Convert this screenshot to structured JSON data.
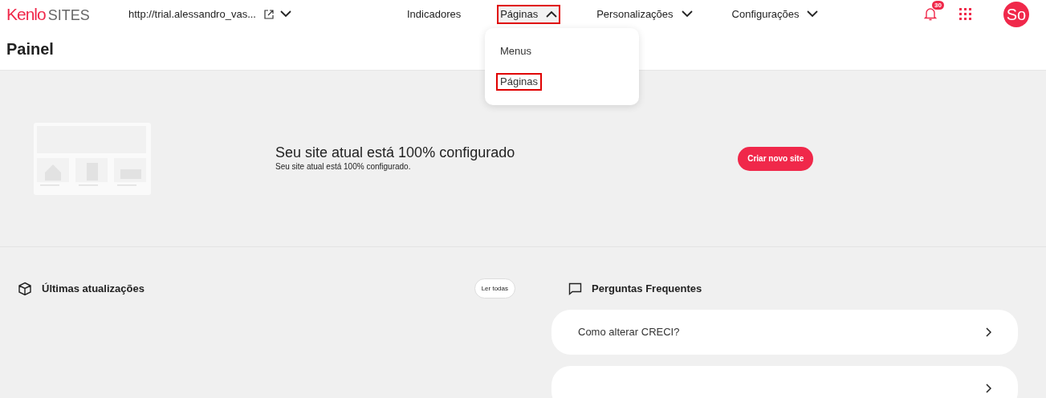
{
  "logo": {
    "brand": "Kenlo",
    "product": "SITES"
  },
  "site_url": "http://trial.alessandro_vas...",
  "nav": [
    {
      "label": "Indicadores",
      "has_menu": false,
      "expanded": false,
      "highlighted": false
    },
    {
      "label": "Páginas",
      "has_menu": true,
      "expanded": true,
      "highlighted": true
    },
    {
      "label": "Personalizações",
      "has_menu": true,
      "expanded": false,
      "highlighted": false
    },
    {
      "label": "Configurações",
      "has_menu": true,
      "expanded": false,
      "highlighted": false
    }
  ],
  "dropdown": [
    {
      "label": "Menus",
      "highlighted": false
    },
    {
      "label": "Páginas",
      "highlighted": true
    }
  ],
  "notifications": {
    "count": "30"
  },
  "avatar": {
    "initials": "So"
  },
  "page_title": "Painel",
  "hero": {
    "title": "Seu site atual está 100% configurado",
    "subtitle": "Seu site atual está 100% configurado.",
    "button": "Criar novo site"
  },
  "updates": {
    "title": "Últimas atualizações",
    "button": "Ler todas"
  },
  "faq": {
    "title": "Perguntas Frequentes",
    "items": [
      {
        "kind": "question",
        "question": "Como alterar CRECI?"
      },
      {
        "kind": "cut_off"
      }
    ]
  }
}
